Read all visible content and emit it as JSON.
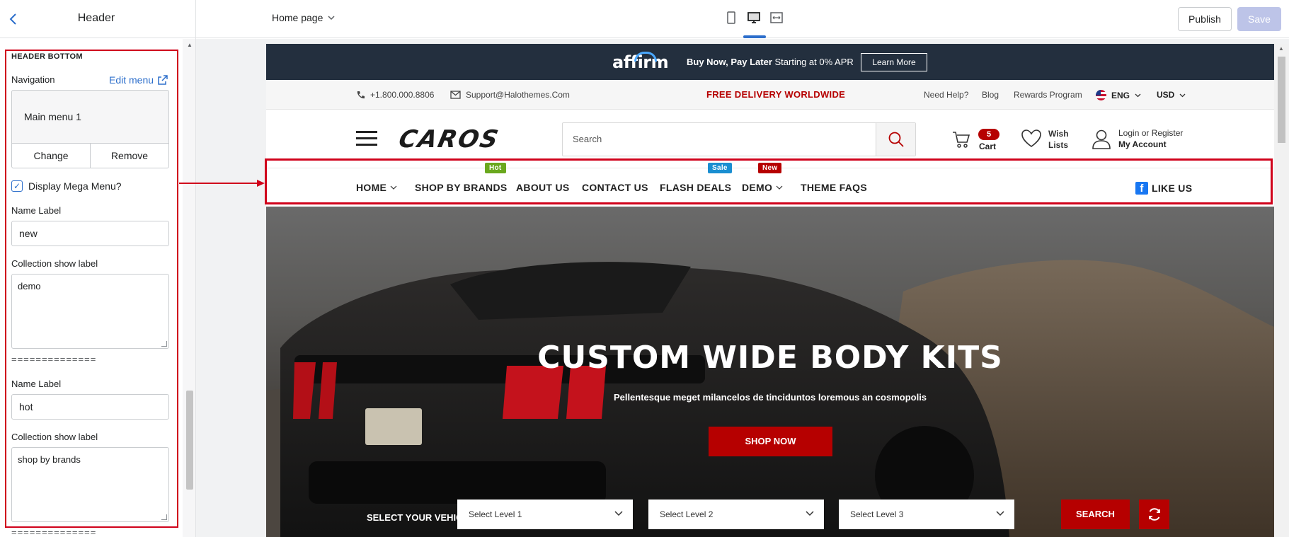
{
  "editor": {
    "panel_title": "Header",
    "page_selector": "Home page",
    "publish_label": "Publish",
    "save_label": "Save"
  },
  "panel": {
    "section_title": "HEADER BOTTOM",
    "navigation_label": "Navigation",
    "edit_menu_label": "Edit menu",
    "selected_menu": "Main menu 1",
    "change_label": "Change",
    "remove_label": "Remove",
    "mega_menu_label": "Display Mega Menu?",
    "mega_menu_checked": true,
    "separator": "==============",
    "groups": [
      {
        "name_label_title": "Name Label",
        "name_label_value": "new",
        "collection_title": "Collection show label",
        "collection_value": "demo"
      },
      {
        "name_label_title": "Name Label",
        "name_label_value": "hot",
        "collection_title": "Collection show label",
        "collection_value": "shop by brands"
      }
    ]
  },
  "preview": {
    "promo": {
      "brand": "affirm",
      "text_bold": "Buy Now, Pay Later",
      "text_rest": " Starting at 0% APR",
      "button": "Learn More"
    },
    "util": {
      "phone": "+1.800.000.8806",
      "email": "Support@Halothemes.Com",
      "free_delivery": "FREE DELIVERY WORLDWIDE",
      "help": "Need Help?",
      "blog": "Blog",
      "rewards": "Rewards Program",
      "language": "ENG",
      "currency": "USD"
    },
    "header": {
      "logo": "CAROS",
      "search_placeholder": "Search",
      "cart_count": "5",
      "cart_label": "Cart",
      "wish_line1": "Wish",
      "wish_line2": "Lists",
      "account_line1": "Login or Register",
      "account_line2": "My Account"
    },
    "nav": {
      "items": [
        "HOME",
        "SHOP BY BRANDS",
        "ABOUT US",
        "CONTACT US",
        "FLASH DEALS",
        "DEMO",
        "THEME FAQS"
      ],
      "badges": {
        "hot": "Hot",
        "sale": "Sale",
        "new": "New"
      },
      "like_us": "LIKE US",
      "badge_colors": {
        "hot": "#6aa81e",
        "sale": "#1a8ed1",
        "new": "#b60000"
      }
    },
    "hero": {
      "title": "CUSTOM WIDE BODY KITS",
      "subtitle": "Pellentesque meget milancelos de tinciduntos loremous an cosmopolis",
      "cta": "SHOP NOW",
      "vehicle_label": "SELECT YOUR VEHICLE",
      "levels": [
        "Select Level 1",
        "Select Level 2",
        "Select Level 3"
      ],
      "search_label": "SEARCH"
    }
  },
  "colors": {
    "accent": "#2c6ecb",
    "brand_red": "#b60000",
    "highlight": "#d0021b"
  }
}
